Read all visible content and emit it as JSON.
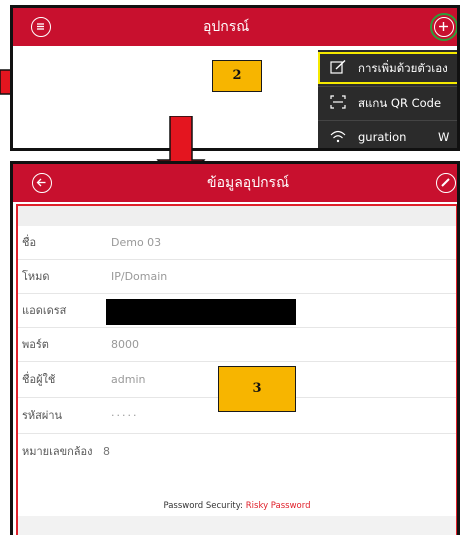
{
  "top_screen": {
    "title": "อุปกรณ์",
    "menu_icon": "menu-circle-icon",
    "add_icon": "plus-circle-icon",
    "dropdown": [
      {
        "label": "การเพิ่มด้วยตัวเอง",
        "icon": "edit-square-icon",
        "highlighted": true
      },
      {
        "label": "สแกน QR Code",
        "icon": "qr-scan-icon",
        "highlighted": false
      },
      {
        "label": "guration",
        "extra": "W",
        "icon": "wifi-icon",
        "highlighted": false
      }
    ]
  },
  "steps": {
    "step2": "2",
    "step3": "3"
  },
  "bottom_screen": {
    "title": "ข้อมูลอุปกรณ์",
    "back_icon": "back-circle-icon",
    "edit_icon": "edit-pencil-circle-icon",
    "fields": [
      {
        "label": "ชื่อ",
        "value": "Demo 03"
      },
      {
        "label": "โหมด",
        "value": "IP/Domain"
      },
      {
        "label": "แอดเดรส",
        "value": ""
      },
      {
        "label": "พอร์ต",
        "value": "8000"
      },
      {
        "label": "ชื่อผู้ใช้",
        "value": "admin"
      },
      {
        "label": "รหัสผ่าน",
        "value": "·····"
      },
      {
        "label": "หมายเลขกล้อง",
        "value": "8"
      }
    ],
    "password_security_label": "Password Security:",
    "password_security_value": "Risky Password"
  },
  "colors": {
    "header_red": "#c8102e",
    "arrow_red": "#e4151f",
    "badge_yellow": "#f7b500",
    "highlight_yellow": "#f5e900",
    "add_ring_green": "#2e9e3a"
  }
}
